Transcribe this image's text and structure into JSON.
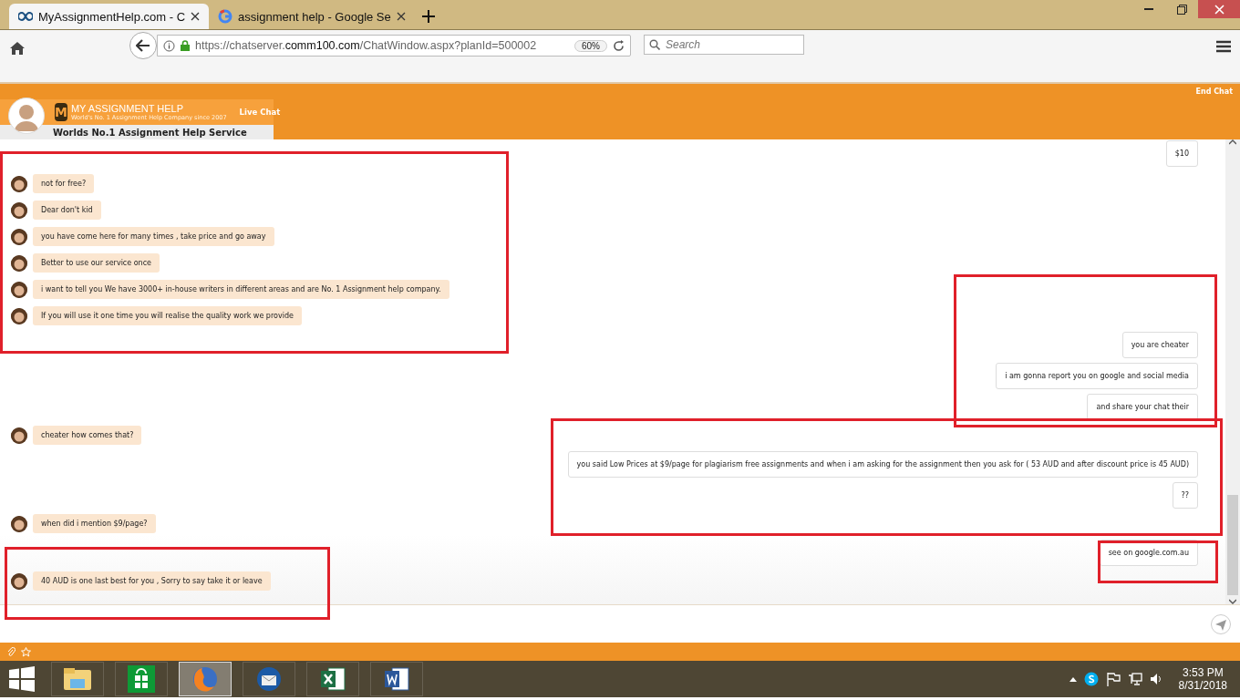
{
  "browser": {
    "tabs": [
      {
        "title": "MyAssignmentHelp.com - C",
        "kind": "infinity",
        "selected": true
      },
      {
        "title": "assignment help - Google Se",
        "kind": "google",
        "selected": false
      }
    ],
    "url_prefix": "https://chatserver.",
    "url_domain": "comm100.com",
    "url_path": "/ChatWindow.aspx?planId=500002",
    "zoom": "60%",
    "search": {
      "placeholder": "Search"
    }
  },
  "chat_header": {
    "logo_letter": "M",
    "brand": "MY ASSIGNMENT HELP",
    "tagline": "World's No. 1 Assignment Help Company since 2007",
    "live": "Live Chat",
    "service": "Worlds No.1 Assignment Help Service",
    "end_chat": "End Chat"
  },
  "messages": [
    {
      "kind": "visitor",
      "text": "$10"
    },
    {
      "kind": "agent",
      "text": "not for free?"
    },
    {
      "kind": "agent",
      "text": "Dear don't kid"
    },
    {
      "kind": "agent",
      "text": "you have come here for many times , take price and go away"
    },
    {
      "kind": "agent",
      "text": "Better to use our service once"
    },
    {
      "kind": "agent",
      "text": "i want to tell you We have 3000+ in-house writers in different areas and are No. 1 Assignment help company."
    },
    {
      "kind": "agent",
      "text": "If you will use it one time you will realise the quality work we provide"
    },
    {
      "kind": "visitor",
      "text": "you are cheater"
    },
    {
      "kind": "visitor",
      "text": "i am gonna report you on google and social media"
    },
    {
      "kind": "visitor",
      "text": "and share your chat their"
    },
    {
      "kind": "agent",
      "text": "cheater how comes that?"
    },
    {
      "kind": "visitor",
      "text": "you said Low Prices at $9/page for plagiarism free assignments and when i am asking for the assignment then you ask for ( 53 AUD and after discount price is 45 AUD)"
    },
    {
      "kind": "visitor",
      "text": "??"
    },
    {
      "kind": "agent",
      "text": "when did i mention $9/page?"
    },
    {
      "kind": "visitor",
      "text": "see on google.com.au"
    },
    {
      "kind": "agent",
      "text": "40 AUD is one last best for you , Sorry to say take it or leave"
    }
  ],
  "taskbar": {
    "apps": [
      {
        "kind": "explorer",
        "selected": false
      },
      {
        "kind": "store",
        "selected": false
      },
      {
        "kind": "firefox",
        "selected": true
      },
      {
        "kind": "thunderbird",
        "selected": false
      },
      {
        "kind": "excel",
        "selected": false
      },
      {
        "kind": "word",
        "selected": false
      }
    ],
    "time": "3:53 PM",
    "date": "8/31/2018"
  }
}
